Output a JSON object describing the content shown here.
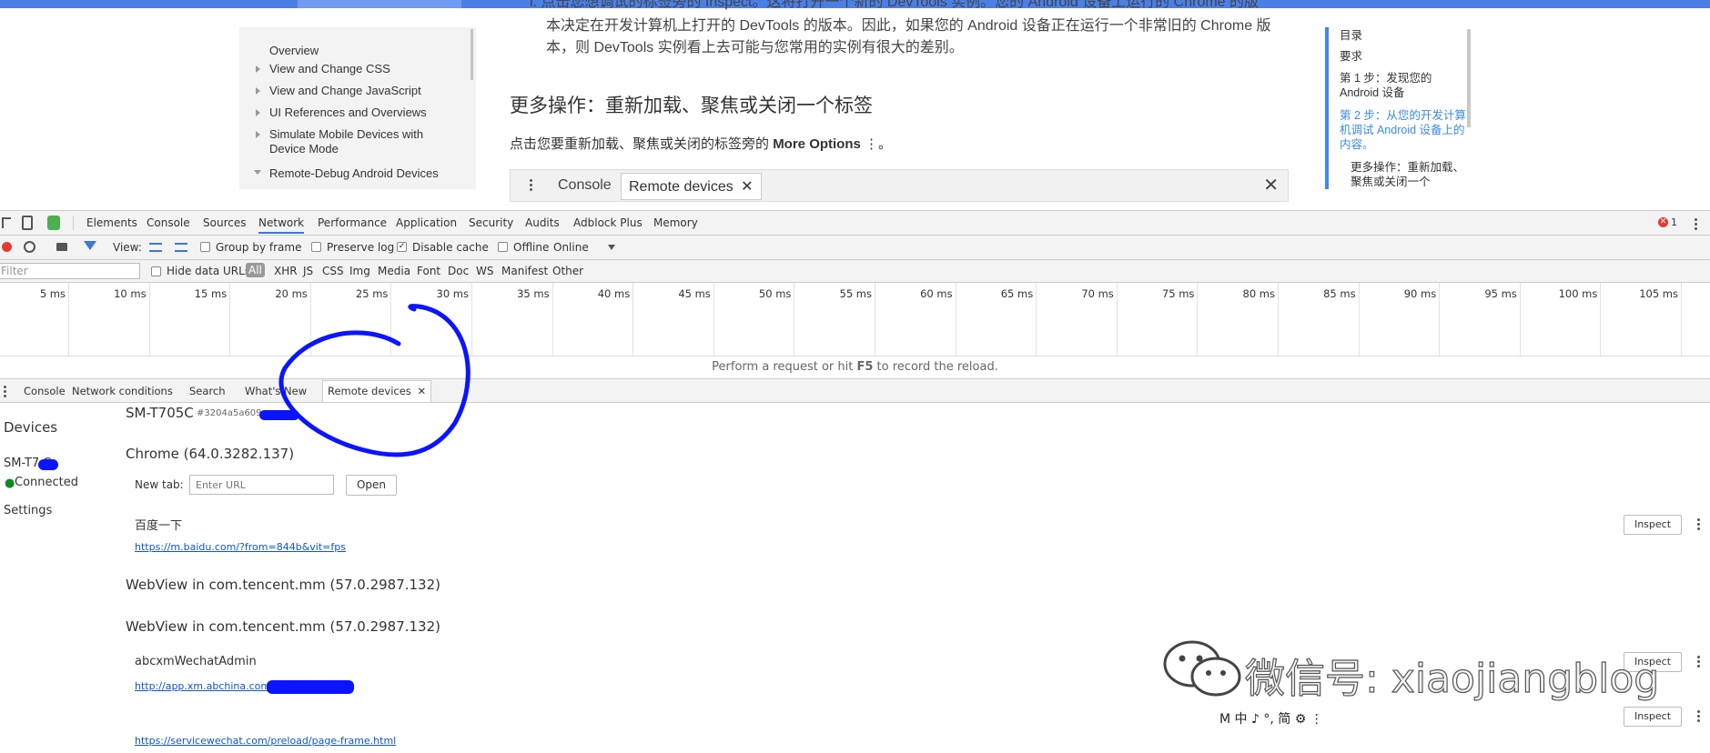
{
  "browser": {
    "accent": "#4a7fe6"
  },
  "docnav": {
    "items": [
      {
        "label": "Overview",
        "arrow": "none"
      },
      {
        "label": "View and Change CSS",
        "arrow": "right"
      },
      {
        "label": "View and Change JavaScript",
        "arrow": "right"
      },
      {
        "label": "UI References and Overviews",
        "arrow": "right"
      },
      {
        "label": "Simulate Mobile Devices with",
        "label2": "Device Mode",
        "arrow": "right"
      },
      {
        "label": "Remote-Debug Android Devices",
        "arrow": "down"
      }
    ]
  },
  "article": {
    "line_top": "i. 点击您想调试的标签旁的 Inspect。这将打开一个新的 DevTools 实例。您的 Android 设备上运行的 Chrome 的版",
    "line1": "本决定在开发计算机上打开的 DevTools 的版本。因此，如果您的 Android 设备正在运行一个非常旧的 Chrome 版",
    "line2": "本，则 DevTools 实例看上去可能与您常用的实例有很大的差别。",
    "heading": "更多操作：重新加载、聚焦或关闭一个标签",
    "para_prefix": "点击您要重新加载、聚焦或关闭的标签旁的",
    "para_bold": "More Options",
    "para_suffix": "⋮。",
    "mini_tabs": {
      "console": "Console",
      "remote": "Remote devices"
    }
  },
  "toc": {
    "items": [
      {
        "label": "目录",
        "active": false
      },
      {
        "label": "要求",
        "active": false
      },
      {
        "label": "第 1 步：发现您的 Android 设备",
        "active": false
      },
      {
        "label": "第 2 步：从您的开发计算机调试 Android 设备上的内容。",
        "active": true
      },
      {
        "label": "更多操作：重新加载、聚焦或关闭一个",
        "active": false
      }
    ]
  },
  "devtools": {
    "tabs": [
      "Elements",
      "Console",
      "Sources",
      "Network",
      "Performance",
      "Application",
      "Security",
      "Audits",
      "Adblock Plus",
      "Memory"
    ],
    "active_tab": "Network",
    "error_count": "1",
    "toolbar": {
      "view_label": "View:",
      "group_by_frame": "Group by frame",
      "preserve_log": "Preserve log",
      "disable_cache": "Disable cache",
      "offline": "Offline",
      "throttle": "Online"
    },
    "filterbar": {
      "filter_placeholder": "Filter",
      "hide_data_urls": "Hide data URLs",
      "types": [
        "All",
        "XHR",
        "JS",
        "CSS",
        "Img",
        "Media",
        "Font",
        "Doc",
        "WS",
        "Manifest",
        "Other"
      ]
    },
    "timeline_ticks": [
      "5 ms",
      "10 ms",
      "15 ms",
      "20 ms",
      "25 ms",
      "30 ms",
      "35 ms",
      "40 ms",
      "45 ms",
      "50 ms",
      "55 ms",
      "60 ms",
      "65 ms",
      "70 ms",
      "75 ms",
      "80 ms",
      "85 ms",
      "90 ms",
      "95 ms",
      "100 ms",
      "105 ms"
    ],
    "record_msg_prefix": "Perform a request or hit ",
    "record_msg_key": "F5",
    "record_msg_suffix": " to record the reload.",
    "drawer_tabs": [
      "Console",
      "Network conditions",
      "Search",
      "What's New",
      "Remote devices"
    ]
  },
  "remote_devices": {
    "sidebar": {
      "heading": "Devices",
      "device": "SM-T7  C",
      "status": "Connected",
      "status_color": "#0c8a1e",
      "settings": "Settings"
    },
    "device_name": "SM-T705C",
    "device_serial": "#3204a5a609",
    "browser": "Chrome (64.0.3282.137)",
    "new_tab_label": "New tab:",
    "new_tab_placeholder": "Enter URL",
    "open_button": "Open",
    "pages": [
      {
        "title": "百度一下",
        "url": "https://m.baidu.com/?from=844b&vit=fps",
        "inspect": "Inspect"
      }
    ],
    "webview1": "WebView in com.tencent.mm (57.0.2987.132)",
    "webview2": "WebView in com.tencent.mm (57.0.2987.132)",
    "wv_pages": [
      {
        "title": "abcxmWechatAdmin",
        "url": "http://app.xm.abchina.com/",
        "inspect": "Inspect"
      },
      {
        "title": "",
        "url": "https://servicewechat.com/preload/page-frame.html",
        "inspect": "Inspect"
      }
    ]
  },
  "watermark": {
    "text": "微信号: xiaojiangblog",
    "ime_bar": "M 中 ♪ °, 简 ⚙ ⋮"
  }
}
